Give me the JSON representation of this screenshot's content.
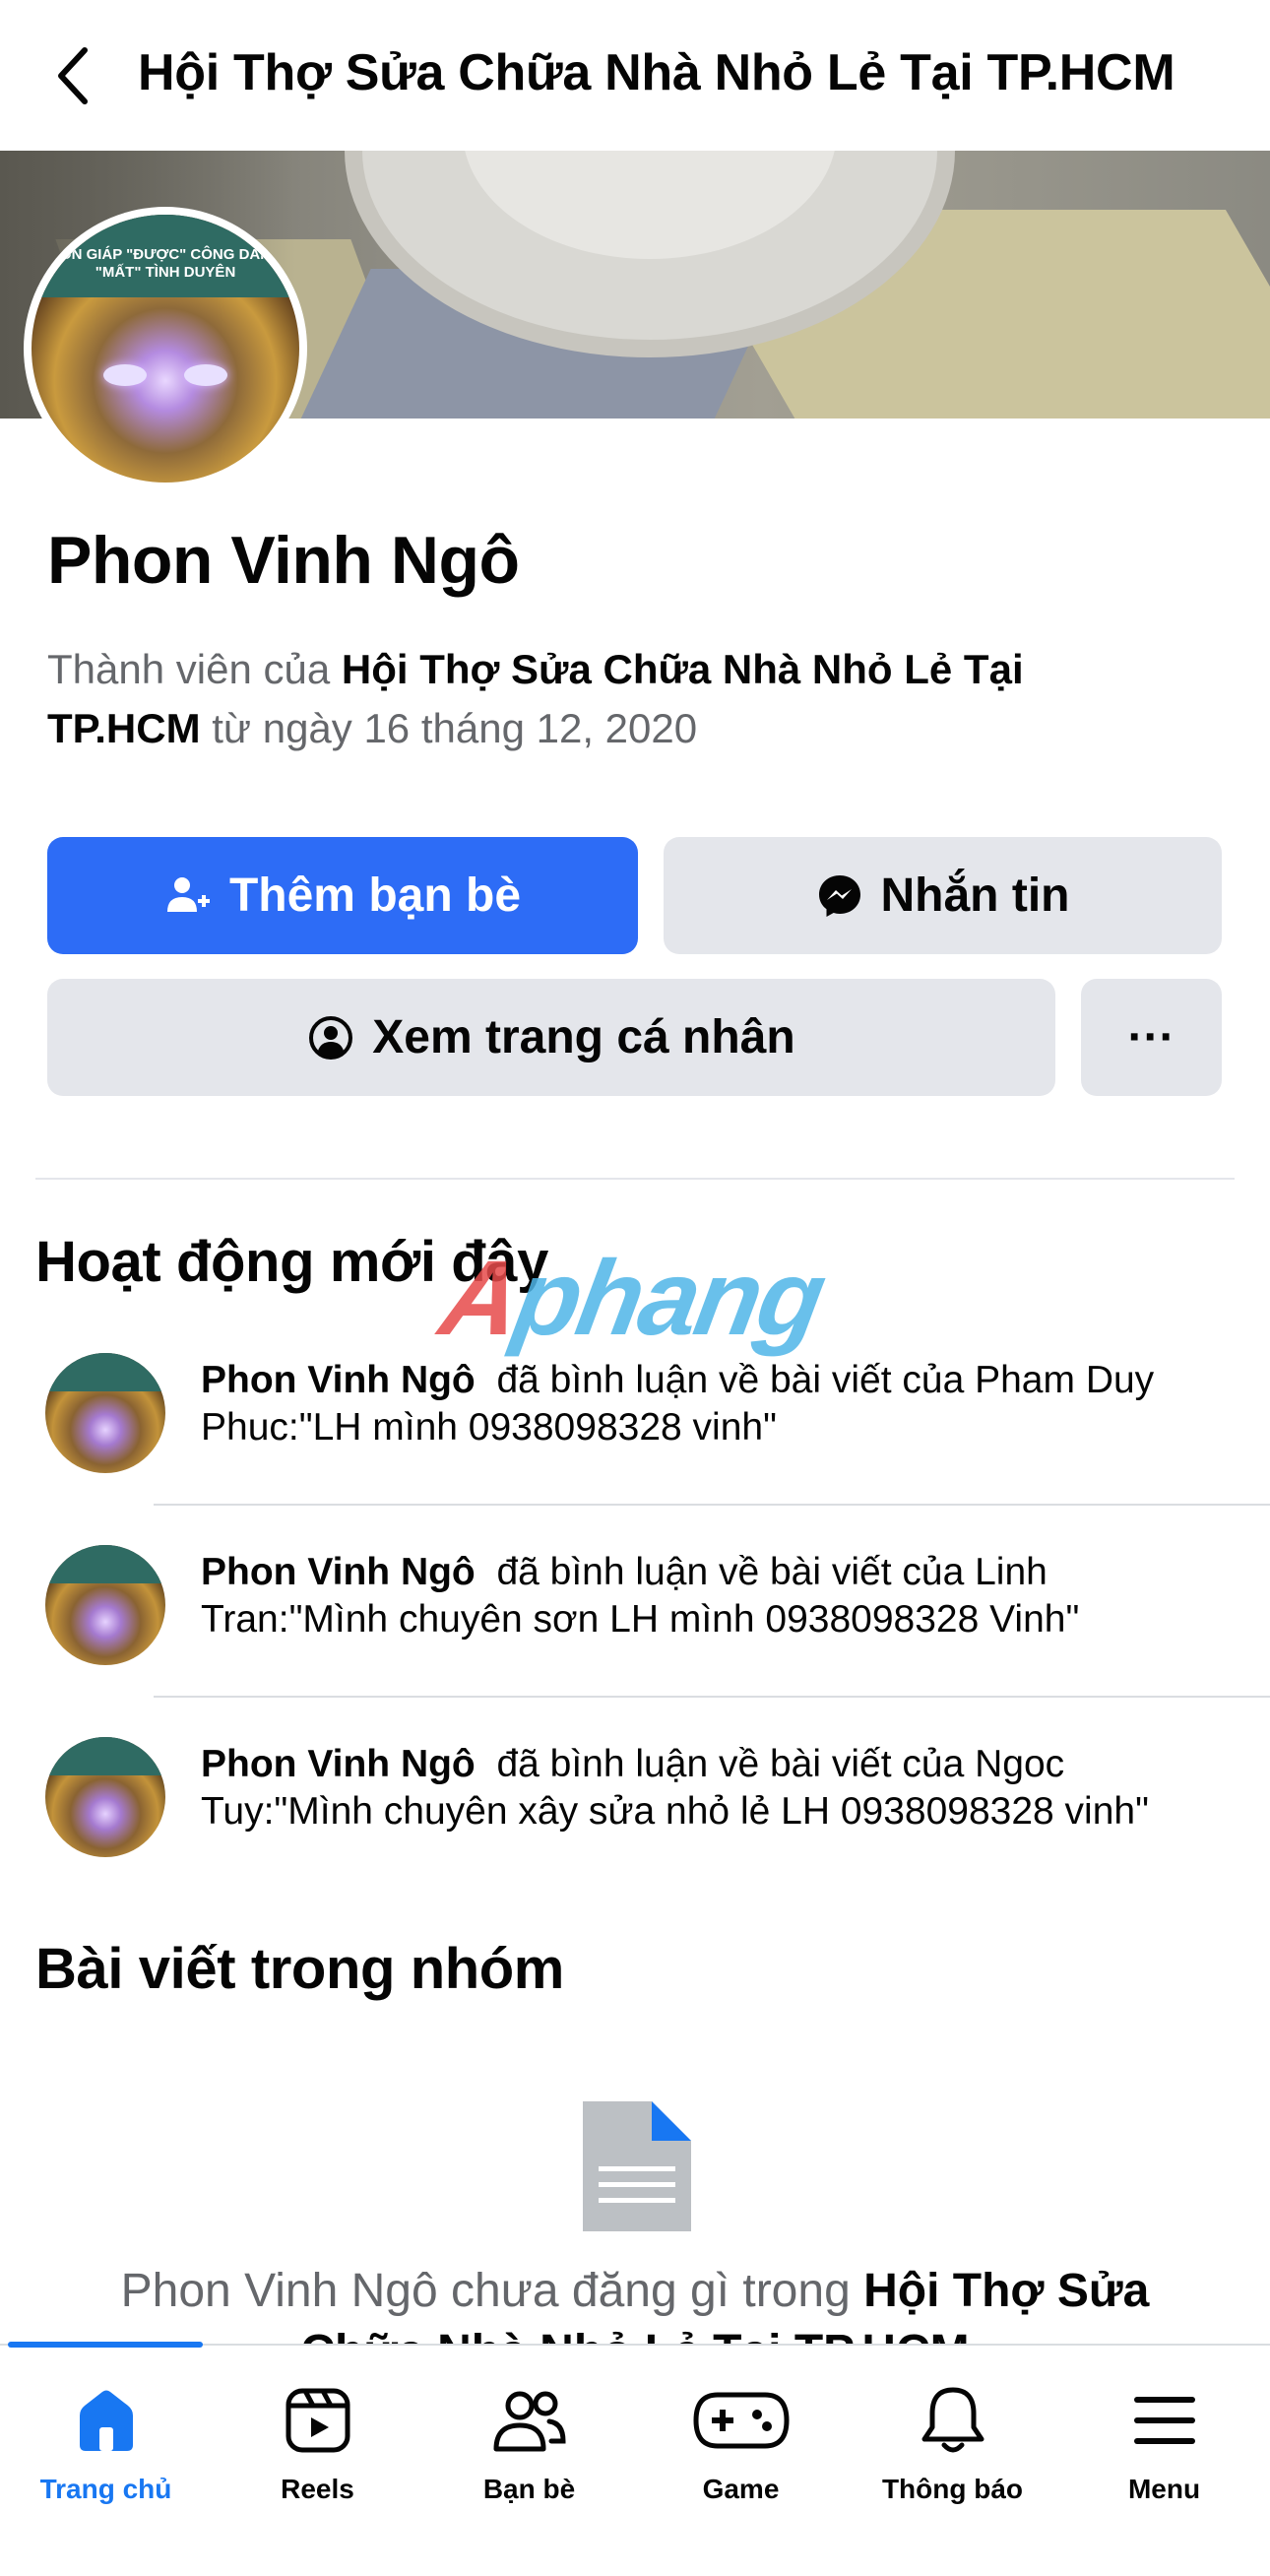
{
  "header": {
    "title": "Hội Thợ Sửa Chữa Nhà Nhỏ Lẻ Tại TP.HCM"
  },
  "avatar": {
    "banner_line1": "CON GIÁP \"ĐƯỢC\" CÔNG DANH",
    "banner_line2": "\"MẤT\" TÌNH DUYÊN"
  },
  "profile": {
    "name": "Phon Vinh Ngô",
    "member_prefix": "Thành viên của",
    "group_name": "Hội Thợ Sửa Chữa Nhà Nhỏ Lẻ Tại TP.HCM",
    "member_suffix": "từ ngày 16 tháng 12, 2020"
  },
  "actions": {
    "add_friend": "Thêm bạn bè",
    "message": "Nhắn tin",
    "view_profile": "Xem trang cá nhân",
    "more": "···"
  },
  "recent_activity": {
    "title": "Hoạt động mới đây",
    "items": [
      {
        "name": "Phon Vinh Ngô",
        "text": "đã bình luận về bài viết của Pham Duy Phuc:\"LH mình 0938098328 vinh\""
      },
      {
        "name": "Phon Vinh Ngô",
        "text": "đã bình luận về bài viết của Linh Tran:\"Mình chuyên sơn LH mình 0938098328 Vinh\""
      },
      {
        "name": "Phon Vinh Ngô",
        "text": "đã bình luận về bài viết của Ngoc Tuy:\"Mình chuyên xây sửa nhỏ lẻ LH 0938098328 vinh\""
      }
    ]
  },
  "watermark": {
    "part1": "A",
    "part2": "phang"
  },
  "group_posts": {
    "title": "Bài viết trong nhóm",
    "empty_prefix": "Phon Vinh Ngô chưa đăng gì trong",
    "empty_group": "Hội Thợ Sửa Chữa Nhà Nhỏ Lẻ Tại TP.HCM"
  },
  "bottom_nav": {
    "items": [
      {
        "label": "Trang chủ",
        "icon": "home-icon",
        "active": true
      },
      {
        "label": "Reels",
        "icon": "reels-icon"
      },
      {
        "label": "Bạn bè",
        "icon": "friends-icon"
      },
      {
        "label": "Game",
        "icon": "gamepad-icon"
      },
      {
        "label": "Thông báo",
        "icon": "bell-icon"
      },
      {
        "label": "Menu",
        "icon": "menu-icon"
      }
    ]
  },
  "colors": {
    "primary": "#2d6cf6",
    "nav_active": "#1877f2",
    "secondary_button": "#e4e6eb",
    "muted_text": "#65676b"
  }
}
